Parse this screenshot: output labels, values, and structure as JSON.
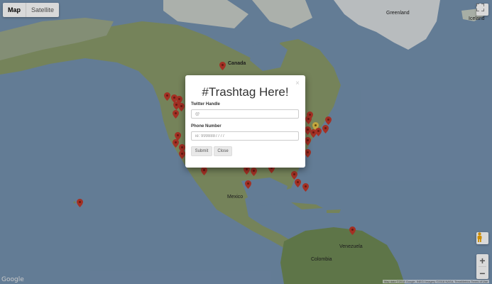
{
  "map": {
    "type_control": {
      "map_label": "Map",
      "satellite_label": "Satellite"
    },
    "labels": {
      "greenland": "Greenland",
      "iceland": "Iceland",
      "canada": "Canada",
      "mexico": "Mexico",
      "venezuela": "Venezuela",
      "colombia": "Colombia",
      "google": "Google",
      "attribution": "Map data ©2018 Google, INEGI Imagery ©2018 NASA, TerraMetrics  Terms of Use"
    },
    "colors": {
      "ocean": "#7592b0",
      "land": "#8a9b6a",
      "ice": "#d9dde0",
      "marker": "#c0392b"
    },
    "icons": {
      "fullscreen": "fullscreen-icon",
      "pegman": "pegman-icon",
      "zoom_in": "+",
      "zoom_out": "−"
    }
  },
  "modal": {
    "title": "#Trashtag Here!",
    "close_x": "×",
    "twitter": {
      "label": "Twitter Handle",
      "placeholder": "@"
    },
    "phone": {
      "label": "Phone Number",
      "placeholder": "ie: 9998887777"
    },
    "submit_label": "Submit",
    "close_label": "Close"
  }
}
